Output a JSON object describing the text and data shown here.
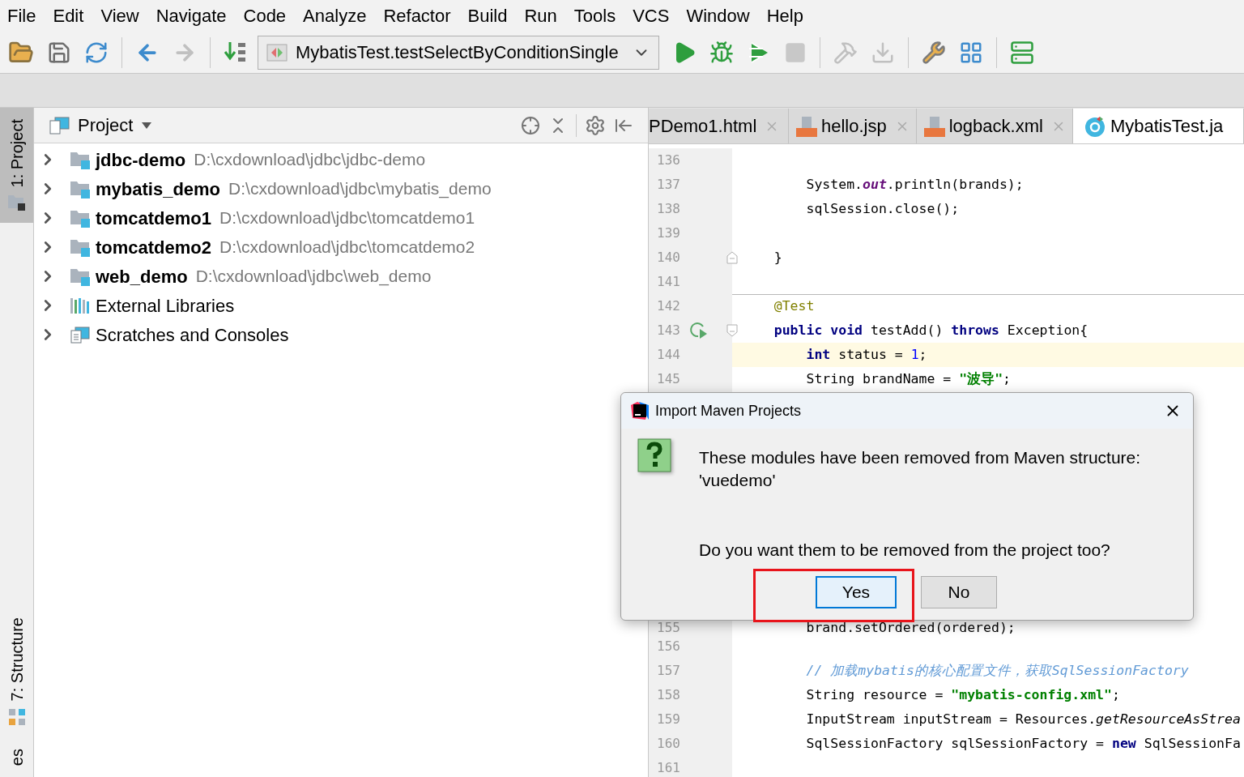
{
  "menu_bar": [
    "File",
    "Edit",
    "View",
    "Navigate",
    "Code",
    "Analyze",
    "Refactor",
    "Build",
    "Run",
    "Tools",
    "VCS",
    "Window",
    "Help"
  ],
  "toolbar": {
    "run_configuration": "MybatisTest.testSelectByConditionSingle"
  },
  "side_tabs_top": [
    {
      "label": "1: Project",
      "selected": true
    }
  ],
  "side_tabs_bottom": [
    {
      "label": "7: Structure",
      "selected": false
    },
    {
      "label": "es",
      "selected": false
    }
  ],
  "project_panel": {
    "title": "Project",
    "tree": [
      {
        "kind": "module",
        "name": "jdbc-demo",
        "path": "D:\\cxdownload\\jdbc\\jdbc-demo",
        "expanded": false
      },
      {
        "kind": "module",
        "name": "mybatis_demo",
        "path": "D:\\cxdownload\\jdbc\\mybatis_demo",
        "expanded": false
      },
      {
        "kind": "module",
        "name": "tomcatdemo1",
        "path": "D:\\cxdownload\\jdbc\\tomcatdemo1",
        "expanded": false
      },
      {
        "kind": "module",
        "name": "tomcatdemo2",
        "path": "D:\\cxdownload\\jdbc\\tomcatdemo2",
        "expanded": false
      },
      {
        "kind": "module",
        "name": "web_demo",
        "path": "D:\\cxdownload\\jdbc\\web_demo",
        "expanded": false
      },
      {
        "kind": "libraries",
        "name": "External Libraries",
        "expanded": false
      },
      {
        "kind": "scratches",
        "name": "Scratches and Consoles",
        "expanded": false
      }
    ]
  },
  "editor_tabs": [
    {
      "label": "PDemo1.html",
      "kind": "html",
      "selected": false
    },
    {
      "label": "hello.jsp",
      "kind": "jsp",
      "selected": false
    },
    {
      "label": "logback.xml",
      "kind": "xml",
      "selected": false
    },
    {
      "label": "MybatisTest.ja",
      "kind": "java",
      "selected": true
    }
  ],
  "code_lines": [
    {
      "number": "136"
    },
    {
      "number": "137",
      "tokens": [
        {
          "kind": "plain",
          "text": "        System."
        },
        {
          "kind": "static",
          "text": "out"
        },
        {
          "kind": "plain",
          "text": ".println(brands);"
        }
      ]
    },
    {
      "number": "138",
      "tokens": [
        {
          "kind": "plain",
          "text": "        sqlSession.close();"
        }
      ]
    },
    {
      "number": "139"
    },
    {
      "number": "140",
      "fold_end": true,
      "tokens": [
        {
          "kind": "plain",
          "text": "    }"
        }
      ]
    },
    {
      "number": "141"
    },
    {
      "number": "142",
      "separator": true,
      "tokens": [
        {
          "kind": "annotation",
          "text": "    @Test"
        }
      ]
    },
    {
      "number": "143",
      "run_icon": true,
      "fold_start": true,
      "tokens": [
        {
          "kind": "keyword",
          "text": "    public void"
        },
        {
          "kind": "plain",
          "text": " testAdd() "
        },
        {
          "kind": "keyword",
          "text": "throws"
        },
        {
          "kind": "plain",
          "text": " Exception{"
        }
      ]
    },
    {
      "number": "144",
      "current": true,
      "tokens": [
        {
          "kind": "keyword",
          "text": "        int"
        },
        {
          "kind": "plain",
          "text": " status = "
        },
        {
          "kind": "number",
          "text": "1"
        },
        {
          "kind": "plain",
          "text": ";"
        }
      ]
    },
    {
      "number": "145",
      "tokens": [
        {
          "kind": "plain",
          "text": "        String brandName = "
        },
        {
          "kind": "string",
          "text": "\"波导\""
        },
        {
          "kind": "plain",
          "text": ";"
        }
      ]
    }
  ],
  "code_lines_below_dialog": [
    {
      "number": "155",
      "tokens": [
        {
          "kind": "plain",
          "text": "        brand.setOrdered(ordered);"
        }
      ]
    },
    {
      "number": "156"
    },
    {
      "number": "157",
      "tokens": [
        {
          "kind": "comment",
          "text": "        // 加载mybatis的核心配置文件，获取SqlSessionFactory"
        }
      ]
    },
    {
      "number": "158",
      "tokens": [
        {
          "kind": "plain",
          "text": "        String resource = "
        },
        {
          "kind": "string",
          "text": "\"mybatis-config.xml\""
        },
        {
          "kind": "plain",
          "text": ";"
        }
      ]
    },
    {
      "number": "159",
      "tokens": [
        {
          "kind": "plain",
          "text": "        InputStream inputStream = Resources."
        },
        {
          "kind": "static_method",
          "text": "getResourceAsStrea"
        }
      ]
    },
    {
      "number": "160",
      "tokens": [
        {
          "kind": "plain",
          "text": "        SqlSessionFactory sqlSessionFactory = "
        },
        {
          "kind": "keyword",
          "text": "new"
        },
        {
          "kind": "plain",
          "text": " SqlSessionFa"
        }
      ]
    },
    {
      "number": "161"
    }
  ],
  "dialog": {
    "title": "Import Maven Projects",
    "message": "These modules have been removed from Maven structure: 'vuedemo'",
    "question": "Do you want them to be removed from the project too?",
    "buttons": [
      {
        "label": "Yes",
        "selected": true,
        "highlighted": true
      },
      {
        "label": "No",
        "selected": false,
        "highlighted": false
      }
    ]
  }
}
